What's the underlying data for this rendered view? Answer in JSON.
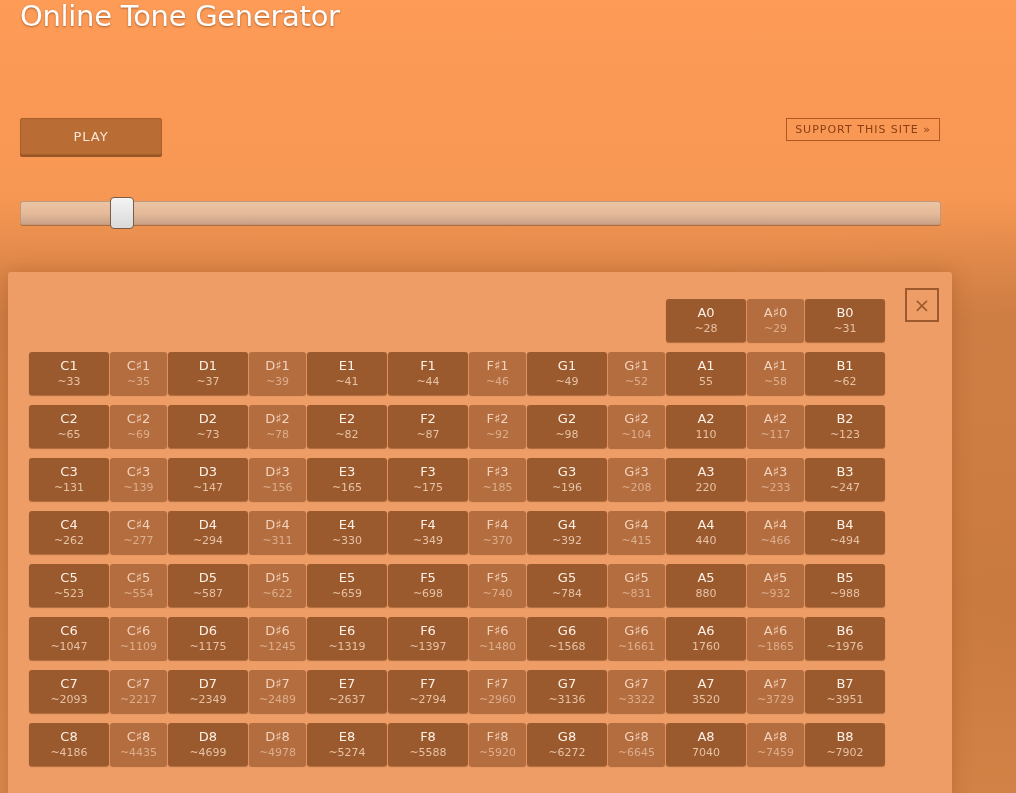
{
  "title": "Online Tone Generator",
  "play_button": "PLAY",
  "support_link": "SUPPORT THIS SITE »",
  "frequency_slider": {
    "level": 0.1
  },
  "note_panel": {
    "close": "×",
    "octaves": [
      {
        "keys": [
          {
            "note": "A0",
            "freq": "~28",
            "kind": "natural"
          },
          {
            "note": "A♯0",
            "freq": "~29",
            "kind": "sharp"
          },
          {
            "note": "B0",
            "freq": "~31",
            "kind": "natural"
          }
        ]
      },
      {
        "keys": [
          {
            "note": "C1",
            "freq": "~33",
            "kind": "natural"
          },
          {
            "note": "C♯1",
            "freq": "~35",
            "kind": "sharp"
          },
          {
            "note": "D1",
            "freq": "~37",
            "kind": "natural"
          },
          {
            "note": "D♯1",
            "freq": "~39",
            "kind": "sharp"
          },
          {
            "note": "E1",
            "freq": "~41",
            "kind": "natural"
          },
          {
            "note": "F1",
            "freq": "~44",
            "kind": "natural"
          },
          {
            "note": "F♯1",
            "freq": "~46",
            "kind": "sharp"
          },
          {
            "note": "G1",
            "freq": "~49",
            "kind": "natural"
          },
          {
            "note": "G♯1",
            "freq": "~52",
            "kind": "sharp"
          },
          {
            "note": "A1",
            "freq": "55",
            "kind": "natural"
          },
          {
            "note": "A♯1",
            "freq": "~58",
            "kind": "sharp"
          },
          {
            "note": "B1",
            "freq": "~62",
            "kind": "natural"
          }
        ]
      },
      {
        "keys": [
          {
            "note": "C2",
            "freq": "~65",
            "kind": "natural"
          },
          {
            "note": "C♯2",
            "freq": "~69",
            "kind": "sharp"
          },
          {
            "note": "D2",
            "freq": "~73",
            "kind": "natural"
          },
          {
            "note": "D♯2",
            "freq": "~78",
            "kind": "sharp"
          },
          {
            "note": "E2",
            "freq": "~82",
            "kind": "natural"
          },
          {
            "note": "F2",
            "freq": "~87",
            "kind": "natural"
          },
          {
            "note": "F♯2",
            "freq": "~92",
            "kind": "sharp"
          },
          {
            "note": "G2",
            "freq": "~98",
            "kind": "natural"
          },
          {
            "note": "G♯2",
            "freq": "~104",
            "kind": "sharp"
          },
          {
            "note": "A2",
            "freq": "110",
            "kind": "natural"
          },
          {
            "note": "A♯2",
            "freq": "~117",
            "kind": "sharp"
          },
          {
            "note": "B2",
            "freq": "~123",
            "kind": "natural"
          }
        ]
      },
      {
        "keys": [
          {
            "note": "C3",
            "freq": "~131",
            "kind": "natural"
          },
          {
            "note": "C♯3",
            "freq": "~139",
            "kind": "sharp"
          },
          {
            "note": "D3",
            "freq": "~147",
            "kind": "natural"
          },
          {
            "note": "D♯3",
            "freq": "~156",
            "kind": "sharp"
          },
          {
            "note": "E3",
            "freq": "~165",
            "kind": "natural"
          },
          {
            "note": "F3",
            "freq": "~175",
            "kind": "natural"
          },
          {
            "note": "F♯3",
            "freq": "~185",
            "kind": "sharp"
          },
          {
            "note": "G3",
            "freq": "~196",
            "kind": "natural"
          },
          {
            "note": "G♯3",
            "freq": "~208",
            "kind": "sharp"
          },
          {
            "note": "A3",
            "freq": "220",
            "kind": "natural"
          },
          {
            "note": "A♯3",
            "freq": "~233",
            "kind": "sharp"
          },
          {
            "note": "B3",
            "freq": "~247",
            "kind": "natural"
          }
        ]
      },
      {
        "keys": [
          {
            "note": "C4",
            "freq": "~262",
            "kind": "natural"
          },
          {
            "note": "C♯4",
            "freq": "~277",
            "kind": "sharp"
          },
          {
            "note": "D4",
            "freq": "~294",
            "kind": "natural"
          },
          {
            "note": "D♯4",
            "freq": "~311",
            "kind": "sharp"
          },
          {
            "note": "E4",
            "freq": "~330",
            "kind": "natural"
          },
          {
            "note": "F4",
            "freq": "~349",
            "kind": "natural"
          },
          {
            "note": "F♯4",
            "freq": "~370",
            "kind": "sharp"
          },
          {
            "note": "G4",
            "freq": "~392",
            "kind": "natural"
          },
          {
            "note": "G♯4",
            "freq": "~415",
            "kind": "sharp"
          },
          {
            "note": "A4",
            "freq": "440",
            "kind": "natural"
          },
          {
            "note": "A♯4",
            "freq": "~466",
            "kind": "sharp"
          },
          {
            "note": "B4",
            "freq": "~494",
            "kind": "natural"
          }
        ]
      },
      {
        "keys": [
          {
            "note": "C5",
            "freq": "~523",
            "kind": "natural"
          },
          {
            "note": "C♯5",
            "freq": "~554",
            "kind": "sharp"
          },
          {
            "note": "D5",
            "freq": "~587",
            "kind": "natural"
          },
          {
            "note": "D♯5",
            "freq": "~622",
            "kind": "sharp"
          },
          {
            "note": "E5",
            "freq": "~659",
            "kind": "natural"
          },
          {
            "note": "F5",
            "freq": "~698",
            "kind": "natural"
          },
          {
            "note": "F♯5",
            "freq": "~740",
            "kind": "sharp"
          },
          {
            "note": "G5",
            "freq": "~784",
            "kind": "natural"
          },
          {
            "note": "G♯5",
            "freq": "~831",
            "kind": "sharp"
          },
          {
            "note": "A5",
            "freq": "880",
            "kind": "natural"
          },
          {
            "note": "A♯5",
            "freq": "~932",
            "kind": "sharp"
          },
          {
            "note": "B5",
            "freq": "~988",
            "kind": "natural"
          }
        ]
      },
      {
        "keys": [
          {
            "note": "C6",
            "freq": "~1047",
            "kind": "natural"
          },
          {
            "note": "C♯6",
            "freq": "~1109",
            "kind": "sharp"
          },
          {
            "note": "D6",
            "freq": "~1175",
            "kind": "natural"
          },
          {
            "note": "D♯6",
            "freq": "~1245",
            "kind": "sharp"
          },
          {
            "note": "E6",
            "freq": "~1319",
            "kind": "natural"
          },
          {
            "note": "F6",
            "freq": "~1397",
            "kind": "natural"
          },
          {
            "note": "F♯6",
            "freq": "~1480",
            "kind": "sharp"
          },
          {
            "note": "G6",
            "freq": "~1568",
            "kind": "natural"
          },
          {
            "note": "G♯6",
            "freq": "~1661",
            "kind": "sharp"
          },
          {
            "note": "A6",
            "freq": "1760",
            "kind": "natural"
          },
          {
            "note": "A♯6",
            "freq": "~1865",
            "kind": "sharp"
          },
          {
            "note": "B6",
            "freq": "~1976",
            "kind": "natural"
          }
        ]
      },
      {
        "keys": [
          {
            "note": "C7",
            "freq": "~2093",
            "kind": "natural"
          },
          {
            "note": "C♯7",
            "freq": "~2217",
            "kind": "sharp"
          },
          {
            "note": "D7",
            "freq": "~2349",
            "kind": "natural"
          },
          {
            "note": "D♯7",
            "freq": "~2489",
            "kind": "sharp"
          },
          {
            "note": "E7",
            "freq": "~2637",
            "kind": "natural"
          },
          {
            "note": "F7",
            "freq": "~2794",
            "kind": "natural"
          },
          {
            "note": "F♯7",
            "freq": "~2960",
            "kind": "sharp"
          },
          {
            "note": "G7",
            "freq": "~3136",
            "kind": "natural"
          },
          {
            "note": "G♯7",
            "freq": "~3322",
            "kind": "sharp"
          },
          {
            "note": "A7",
            "freq": "3520",
            "kind": "natural"
          },
          {
            "note": "A♯7",
            "freq": "~3729",
            "kind": "sharp"
          },
          {
            "note": "B7",
            "freq": "~3951",
            "kind": "natural"
          }
        ]
      },
      {
        "keys": [
          {
            "note": "C8",
            "freq": "~4186",
            "kind": "natural"
          },
          {
            "note": "C♯8",
            "freq": "~4435",
            "kind": "sharp"
          },
          {
            "note": "D8",
            "freq": "~4699",
            "kind": "natural"
          },
          {
            "note": "D♯8",
            "freq": "~4978",
            "kind": "sharp"
          },
          {
            "note": "E8",
            "freq": "~5274",
            "kind": "natural"
          },
          {
            "note": "F8",
            "freq": "~5588",
            "kind": "natural"
          },
          {
            "note": "F♯8",
            "freq": "~5920",
            "kind": "sharp"
          },
          {
            "note": "G8",
            "freq": "~6272",
            "kind": "natural"
          },
          {
            "note": "G♯8",
            "freq": "~6645",
            "kind": "sharp"
          },
          {
            "note": "A8",
            "freq": "7040",
            "kind": "natural"
          },
          {
            "note": "A♯8",
            "freq": "~7459",
            "kind": "sharp"
          },
          {
            "note": "B8",
            "freq": "~7902",
            "kind": "natural"
          }
        ]
      }
    ]
  }
}
